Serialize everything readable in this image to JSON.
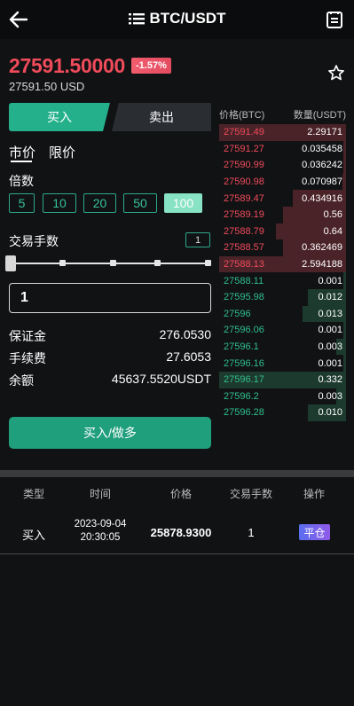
{
  "header": {
    "title": "BTC/USDT",
    "back_icon": "arrow-left-icon",
    "menu_icon": "list-icon",
    "doc_icon": "document-icon"
  },
  "ticker": {
    "price": "27591.50000",
    "change": "-1.57%",
    "usd_price": "27591.50 USD",
    "change_color": "#ef4b5b"
  },
  "trade_tabs": {
    "buy": "买入",
    "sell": "卖出"
  },
  "order_types": {
    "market": "市价",
    "limit": "限价"
  },
  "leverage": {
    "label": "倍数",
    "options": [
      "5",
      "10",
      "20",
      "50",
      "100"
    ],
    "selected": "100"
  },
  "quantity": {
    "label": "交易手数",
    "badge": "1",
    "input_value": "1"
  },
  "info": [
    {
      "label": "保证金",
      "value": "276.0530"
    },
    {
      "label": "手续费",
      "value": "27.6053"
    },
    {
      "label": "余额",
      "value": "45637.5520USDT"
    }
  ],
  "submit_label": "买入/做多",
  "orderbook": {
    "headers": [
      "价格(BTC)",
      "数量(USDT)"
    ],
    "rows": [
      {
        "side": "ask",
        "price": "27591.49",
        "amount": "2.29171",
        "depth": 1.0
      },
      {
        "side": "ask",
        "price": "27591.27",
        "amount": "0.035458",
        "depth": 0.02
      },
      {
        "side": "ask",
        "price": "27590.99",
        "amount": "0.036242",
        "depth": 0.02
      },
      {
        "side": "ask",
        "price": "27590.98",
        "amount": "0.070987",
        "depth": 0.03
      },
      {
        "side": "ask",
        "price": "27589.47",
        "amount": "0.434916",
        "depth": 0.42
      },
      {
        "side": "ask",
        "price": "27589.19",
        "amount": "0.56",
        "depth": 0.5
      },
      {
        "side": "ask",
        "price": "27588.79",
        "amount": "0.64",
        "depth": 0.55
      },
      {
        "side": "ask",
        "price": "27588.57",
        "amount": "0.362469",
        "depth": 0.5
      },
      {
        "side": "ask",
        "price": "27588.13",
        "amount": "2.594188",
        "depth": 1.0
      },
      {
        "side": "bid",
        "price": "27588.11",
        "amount": "0.001",
        "depth": 0.02
      },
      {
        "side": "bid",
        "price": "27595.98",
        "amount": "0.012",
        "depth": 0.3
      },
      {
        "side": "bid",
        "price": "27596",
        "amount": "0.013",
        "depth": 0.34
      },
      {
        "side": "bid",
        "price": "27596.06",
        "amount": "0.001",
        "depth": 0.02
      },
      {
        "side": "bid",
        "price": "27596.1",
        "amount": "0.003",
        "depth": 0.08
      },
      {
        "side": "bid",
        "price": "27596.16",
        "amount": "0.001",
        "depth": 0.02
      },
      {
        "side": "bid",
        "price": "27596.17",
        "amount": "0.332",
        "depth": 1.0
      },
      {
        "side": "bid",
        "price": "27596.2",
        "amount": "0.003",
        "depth": 0.08
      },
      {
        "side": "bid",
        "price": "27596.28",
        "amount": "0.010",
        "depth": 0.3
      }
    ]
  },
  "positions": {
    "headers": [
      "类型",
      "时间",
      "价格",
      "交易手数",
      "操作"
    ],
    "row": {
      "type": "买入",
      "date": "2023-09-04",
      "time": "20:30:05",
      "price": "25878.9300",
      "qty": "1",
      "action": "平仓"
    }
  }
}
